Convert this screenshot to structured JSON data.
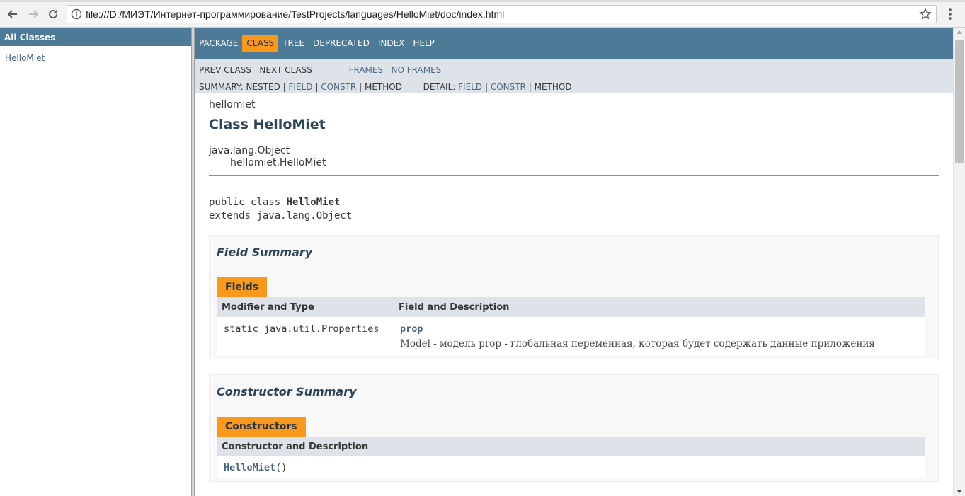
{
  "browser": {
    "url": "file:///D:/МИЭТ/Интернет-программирование/TestProjects/languages/HelloMiet/doc/index.html"
  },
  "left_frame": {
    "header": "All Classes",
    "classes": [
      "HelloMiet"
    ]
  },
  "top_nav": {
    "items": [
      "PACKAGE",
      "CLASS",
      "TREE",
      "DEPRECATED",
      "INDEX",
      "HELP"
    ],
    "active": "CLASS"
  },
  "sub_nav": {
    "prev_class": "PREV CLASS",
    "next_class": "NEXT CLASS",
    "frames": "FRAMES",
    "no_frames": "NO FRAMES",
    "summary_label": "SUMMARY:",
    "summary_nested": "NESTED",
    "summary_field": "FIELD",
    "summary_constr": "CONSTR",
    "summary_method": "METHOD",
    "detail_label": "DETAIL:",
    "detail_field": "FIELD",
    "detail_constr": "CONSTR",
    "detail_method": "METHOD",
    "sep": "|"
  },
  "class_info": {
    "package": "hellomiet",
    "title": "Class HelloMiet",
    "inheritance_root": "java.lang.Object",
    "inheritance_child": "hellomiet.HelloMiet",
    "sig_prefix": "public class ",
    "sig_name": "HelloMiet",
    "sig_extends": "extends java.lang.Object"
  },
  "field_summary": {
    "heading": "Field Summary",
    "caption": "Fields",
    "col1": "Modifier and Type",
    "col2": "Field and Description",
    "rows": [
      {
        "type": "static java.util.Properties",
        "name": "prop",
        "description": "Model - модель prop - глобальная переменная, которая будет содержать данные приложения"
      }
    ]
  },
  "constructor_summary": {
    "heading": "Constructor Summary",
    "caption": "Constructors",
    "col1": "Constructor and Description",
    "rows": [
      {
        "name": "HelloMiet",
        "params": "()"
      }
    ]
  },
  "colors": {
    "nav_bar": "#4d7a97",
    "sub_nav": "#dee3e9",
    "active_tab": "#f8981d",
    "link": "#4a6782"
  }
}
